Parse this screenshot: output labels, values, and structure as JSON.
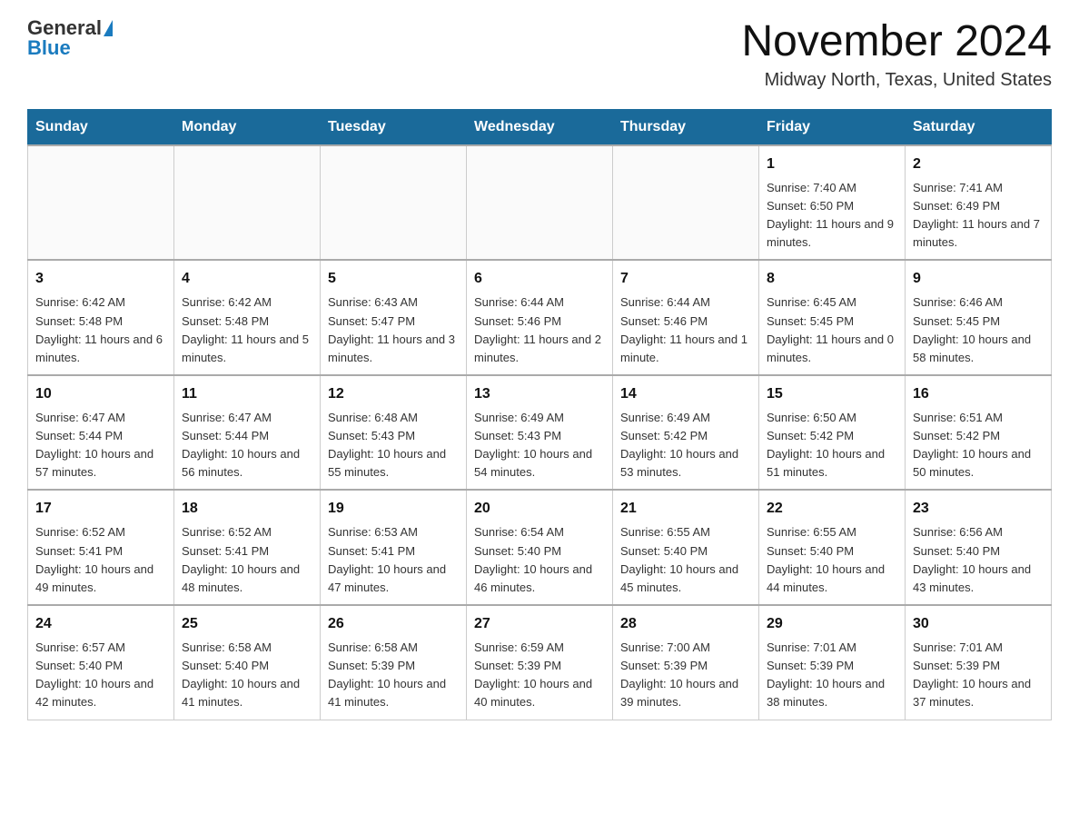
{
  "header": {
    "logo_general": "General",
    "logo_blue": "Blue",
    "title": "November 2024",
    "subtitle": "Midway North, Texas, United States"
  },
  "weekdays": [
    "Sunday",
    "Monday",
    "Tuesday",
    "Wednesday",
    "Thursday",
    "Friday",
    "Saturday"
  ],
  "weeks": [
    [
      {
        "day": "",
        "info": ""
      },
      {
        "day": "",
        "info": ""
      },
      {
        "day": "",
        "info": ""
      },
      {
        "day": "",
        "info": ""
      },
      {
        "day": "",
        "info": ""
      },
      {
        "day": "1",
        "info": "Sunrise: 7:40 AM\nSunset: 6:50 PM\nDaylight: 11 hours and 9 minutes."
      },
      {
        "day": "2",
        "info": "Sunrise: 7:41 AM\nSunset: 6:49 PM\nDaylight: 11 hours and 7 minutes."
      }
    ],
    [
      {
        "day": "3",
        "info": "Sunrise: 6:42 AM\nSunset: 5:48 PM\nDaylight: 11 hours and 6 minutes."
      },
      {
        "day": "4",
        "info": "Sunrise: 6:42 AM\nSunset: 5:48 PM\nDaylight: 11 hours and 5 minutes."
      },
      {
        "day": "5",
        "info": "Sunrise: 6:43 AM\nSunset: 5:47 PM\nDaylight: 11 hours and 3 minutes."
      },
      {
        "day": "6",
        "info": "Sunrise: 6:44 AM\nSunset: 5:46 PM\nDaylight: 11 hours and 2 minutes."
      },
      {
        "day": "7",
        "info": "Sunrise: 6:44 AM\nSunset: 5:46 PM\nDaylight: 11 hours and 1 minute."
      },
      {
        "day": "8",
        "info": "Sunrise: 6:45 AM\nSunset: 5:45 PM\nDaylight: 11 hours and 0 minutes."
      },
      {
        "day": "9",
        "info": "Sunrise: 6:46 AM\nSunset: 5:45 PM\nDaylight: 10 hours and 58 minutes."
      }
    ],
    [
      {
        "day": "10",
        "info": "Sunrise: 6:47 AM\nSunset: 5:44 PM\nDaylight: 10 hours and 57 minutes."
      },
      {
        "day": "11",
        "info": "Sunrise: 6:47 AM\nSunset: 5:44 PM\nDaylight: 10 hours and 56 minutes."
      },
      {
        "day": "12",
        "info": "Sunrise: 6:48 AM\nSunset: 5:43 PM\nDaylight: 10 hours and 55 minutes."
      },
      {
        "day": "13",
        "info": "Sunrise: 6:49 AM\nSunset: 5:43 PM\nDaylight: 10 hours and 54 minutes."
      },
      {
        "day": "14",
        "info": "Sunrise: 6:49 AM\nSunset: 5:42 PM\nDaylight: 10 hours and 53 minutes."
      },
      {
        "day": "15",
        "info": "Sunrise: 6:50 AM\nSunset: 5:42 PM\nDaylight: 10 hours and 51 minutes."
      },
      {
        "day": "16",
        "info": "Sunrise: 6:51 AM\nSunset: 5:42 PM\nDaylight: 10 hours and 50 minutes."
      }
    ],
    [
      {
        "day": "17",
        "info": "Sunrise: 6:52 AM\nSunset: 5:41 PM\nDaylight: 10 hours and 49 minutes."
      },
      {
        "day": "18",
        "info": "Sunrise: 6:52 AM\nSunset: 5:41 PM\nDaylight: 10 hours and 48 minutes."
      },
      {
        "day": "19",
        "info": "Sunrise: 6:53 AM\nSunset: 5:41 PM\nDaylight: 10 hours and 47 minutes."
      },
      {
        "day": "20",
        "info": "Sunrise: 6:54 AM\nSunset: 5:40 PM\nDaylight: 10 hours and 46 minutes."
      },
      {
        "day": "21",
        "info": "Sunrise: 6:55 AM\nSunset: 5:40 PM\nDaylight: 10 hours and 45 minutes."
      },
      {
        "day": "22",
        "info": "Sunrise: 6:55 AM\nSunset: 5:40 PM\nDaylight: 10 hours and 44 minutes."
      },
      {
        "day": "23",
        "info": "Sunrise: 6:56 AM\nSunset: 5:40 PM\nDaylight: 10 hours and 43 minutes."
      }
    ],
    [
      {
        "day": "24",
        "info": "Sunrise: 6:57 AM\nSunset: 5:40 PM\nDaylight: 10 hours and 42 minutes."
      },
      {
        "day": "25",
        "info": "Sunrise: 6:58 AM\nSunset: 5:40 PM\nDaylight: 10 hours and 41 minutes."
      },
      {
        "day": "26",
        "info": "Sunrise: 6:58 AM\nSunset: 5:39 PM\nDaylight: 10 hours and 41 minutes."
      },
      {
        "day": "27",
        "info": "Sunrise: 6:59 AM\nSunset: 5:39 PM\nDaylight: 10 hours and 40 minutes."
      },
      {
        "day": "28",
        "info": "Sunrise: 7:00 AM\nSunset: 5:39 PM\nDaylight: 10 hours and 39 minutes."
      },
      {
        "day": "29",
        "info": "Sunrise: 7:01 AM\nSunset: 5:39 PM\nDaylight: 10 hours and 38 minutes."
      },
      {
        "day": "30",
        "info": "Sunrise: 7:01 AM\nSunset: 5:39 PM\nDaylight: 10 hours and 37 minutes."
      }
    ]
  ]
}
